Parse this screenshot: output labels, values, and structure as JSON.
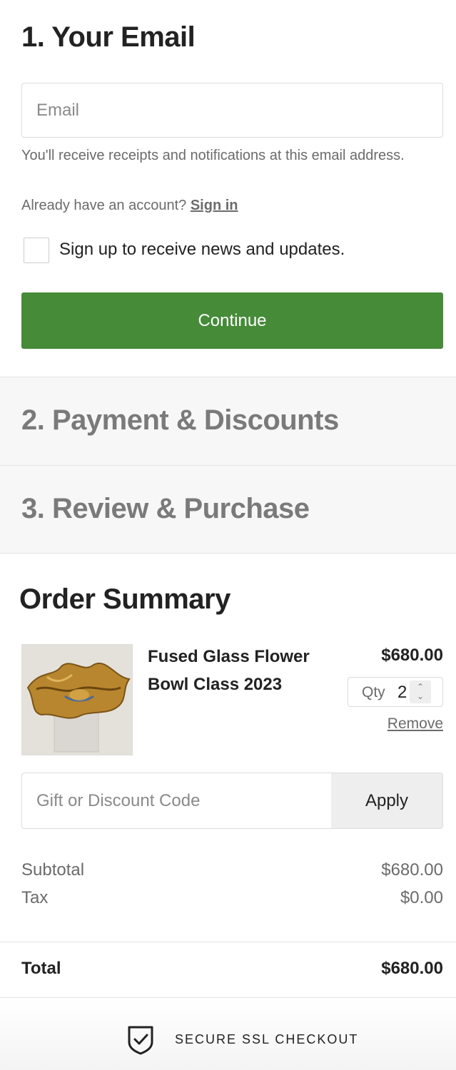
{
  "email_step": {
    "title": "1.  Your Email",
    "email_placeholder": "Email",
    "help_text": "You'll receive receipts and notifications at this email address.",
    "account_prompt": "Already have an account?",
    "sign_in_label": "Sign in",
    "newsletter_label": "Sign up to receive news and updates.",
    "newsletter_checked": false,
    "continue_label": "Continue",
    "continue_color": "#458b38"
  },
  "payment_step": {
    "title": "2.  Payment & Discounts"
  },
  "review_step": {
    "title": "3.  Review & Purchase"
  },
  "order_summary": {
    "title": "Order Summary",
    "item": {
      "name": "Fused Glass Flower Bowl Class 2023",
      "price": "$680.00",
      "qty_label": "Qty",
      "qty_value": "2",
      "remove_label": "Remove"
    },
    "discount": {
      "placeholder": "Gift or Discount Code",
      "apply_label": "Apply"
    },
    "subtotal_label": "Subtotal",
    "subtotal_value": "$680.00",
    "tax_label": "Tax",
    "tax_value": "$0.00",
    "total_label": "Total",
    "total_value": "$680.00"
  },
  "footer": {
    "secure_text": "SECURE SSL CHECKOUT",
    "icon": "shield-check-icon"
  }
}
